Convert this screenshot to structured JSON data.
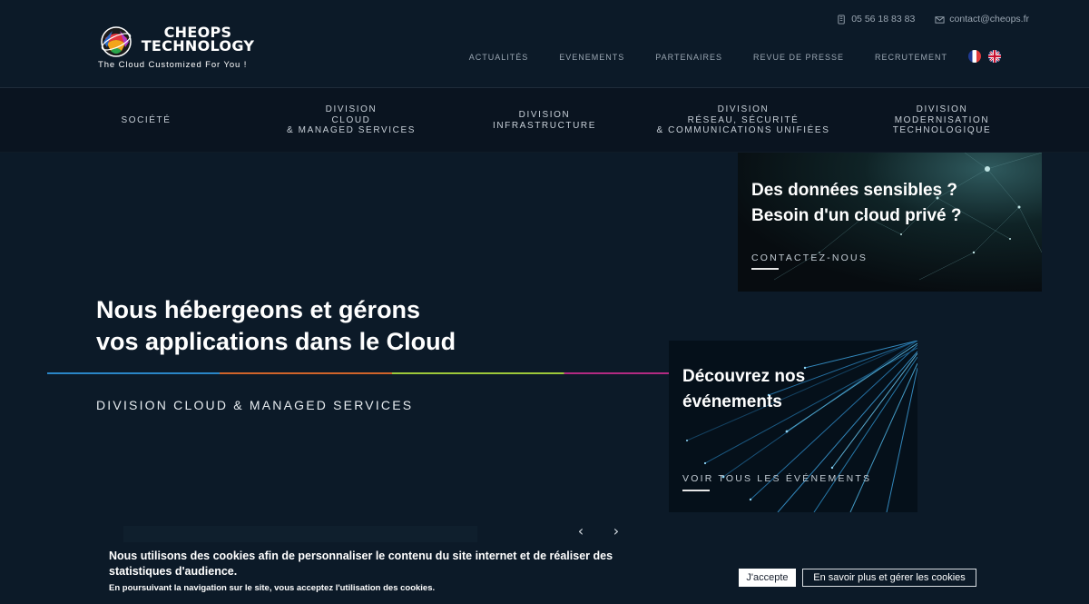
{
  "header": {
    "logo": {
      "name_line1": "CHEOPS",
      "name_line2": "TECHNOLOGY",
      "tagline": "The Cloud Customized For You !"
    },
    "contact": {
      "phone": "05 56 18 83 83",
      "email": "contact@cheops.fr"
    },
    "top_nav": [
      "ACTUALITÉS",
      "EVENEMENTS",
      "PARTENAIRES",
      "REVUE DE PRESSE",
      "RECRUTEMENT"
    ],
    "languages": [
      "fr-flag-icon",
      "uk-flag-icon"
    ]
  },
  "division_nav": [
    "SOCIÉTÉ",
    "DIVISION\nCLOUD\n& MANAGED SERVICES",
    "DIVISION\nINFRASTRUCTURE",
    "DIVISION\nRÉSEAU, SÉCURITÉ\n& COMMUNICATIONS UNIFIÉES",
    "DIVISION\nMODERNISATION\nTECHNOLOGIQUE"
  ],
  "hero": {
    "title_line1": "Nous hébergeons et gérons",
    "title_line2": "vos applications dans le Cloud",
    "subtitle": "DIVISION CLOUD & MANAGED SERVICES",
    "prev_icon": "chevron-left-icon",
    "next_icon": "chevron-right-icon"
  },
  "cards": {
    "private_cloud": {
      "title_line1": "Des données sensibles ?",
      "title_line2": "Besoin d'un cloud privé ?",
      "link": "CONTACTEZ-NOUS"
    },
    "events": {
      "title_line1": "Découvrez nos",
      "title_line2": "événements",
      "link": "VOIR TOUS LES ÉVÉNEMENTS"
    }
  },
  "cookie": {
    "text_main": "Nous utilisons des cookies afin de personnaliser le contenu du site internet et de réaliser des statistiques d'audience.",
    "text_small": "En poursuivant la navigation sur le site, vous acceptez l'utilisation des cookies.",
    "accept_label": "J'accepte",
    "learn_more_label": "En savoir plus et gérer les cookies"
  },
  "colors": {
    "background": "#0c1a28",
    "nav_background": "#0a1420",
    "line_blue": "#2a86c7",
    "line_orange": "#d0642a",
    "line_green": "#9dc83a",
    "line_magenta": "#b32a82"
  }
}
